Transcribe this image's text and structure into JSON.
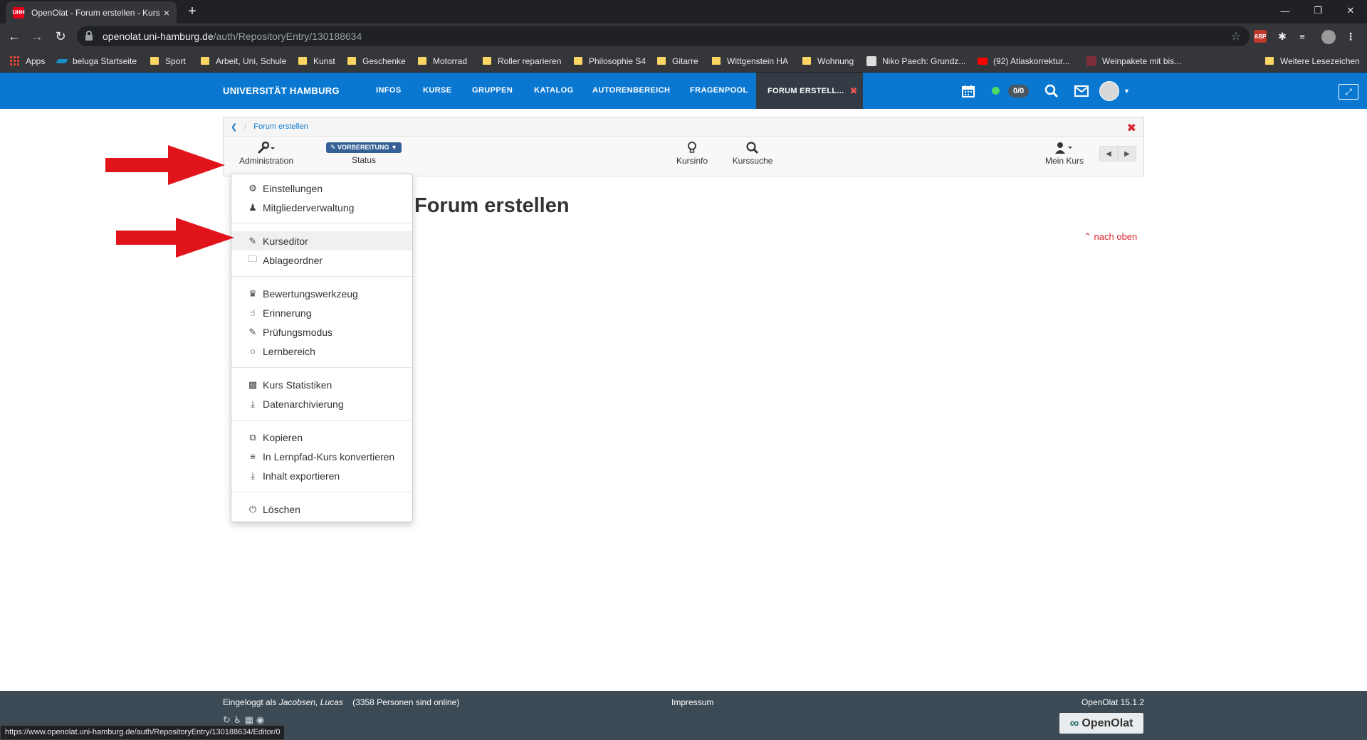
{
  "browser": {
    "tab_title": "OpenOlat - Forum erstellen - Kurs",
    "tab_close": "×",
    "tab_favicon": "UHH",
    "new_tab": "+",
    "url_host": "openolat.uni-hamburg.de",
    "url_path": "/auth/RepositoryEntry/130188634",
    "status_url": "https://www.openolat.uni-hamburg.de/auth/RepositoryEntry/130188634/Editor/0",
    "ext_abp": "ABP"
  },
  "bookmarks": {
    "items": [
      "Apps",
      "beluga Startseite",
      "Sport",
      "Arbeit, Uni, Schule",
      "Kunst",
      "Geschenke",
      "Motorrad",
      "Roller reparieren",
      "Philosophie S4",
      "Gitarre",
      "Wittgenstein HA",
      "Wohnung",
      "Niko Paech: Grundz...",
      "(92) Atlaskorrektur...",
      "Weinpakete mit bis...",
      "Weitere Lesezeichen"
    ]
  },
  "header": {
    "brand": "UNIVERSITÄT HAMBURG",
    "nav": [
      "INFOS",
      "KURSE",
      "GRUPPEN",
      "KATALOG",
      "AUTORENBEREICH",
      "FRAGENPOOL"
    ],
    "active_tab": "FORUM ERSTELL...",
    "counter": "0/0"
  },
  "course": {
    "breadcrumb": "Forum erstellen",
    "admin_label": "Administration",
    "status_badge": "VORBEREITUNG",
    "status_label": "Status",
    "kursinfo_label": "Kursinfo",
    "kurssuche_label": "Kurssuche",
    "mein_kurs_label": "Mein Kurs",
    "page_title": "Forum erstellen",
    "to_top": "nach oben"
  },
  "menu": {
    "items": [
      "Einstellungen",
      "Mitgliederverwaltung",
      "Kurseditor",
      "Ablageordner",
      "Bewertungswerkzeug",
      "Erinnerung",
      "Prüfungsmodus",
      "Lernbereich",
      "Kurs Statistiken",
      "Datenarchivierung",
      "Kopieren",
      "In Lernpfad-Kurs konvertieren",
      "Inhalt exportieren",
      "Löschen"
    ],
    "highlighted": "Kurseditor"
  },
  "footer": {
    "login_prefix": "Eingeloggt als",
    "user": "Jacobsen, Lucas",
    "online": "(3358 Personen sind online)",
    "impressum": "Impressum",
    "version": "OpenOlat 15.1.2",
    "logo": "OpenOlat"
  },
  "colors": {
    "brand_blue": "#0a78d0",
    "active_tab": "#333c45",
    "danger": "#d9262f",
    "arrow": "#e2141b",
    "footer": "#3c4a55"
  }
}
